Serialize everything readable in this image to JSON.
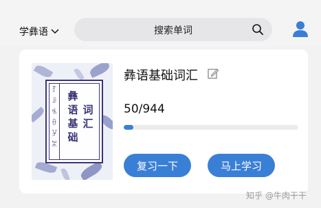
{
  "header": {
    "language": "学彝语",
    "search_placeholder": "搜索单词"
  },
  "book": {
    "title": "彝语基础词汇",
    "cover_title_col1": "彝语基础",
    "cover_title_col2": "词汇",
    "cover_yi_script": "ꆈꌠꁱꂷꐯꄓ"
  },
  "progress": {
    "text": "50/944",
    "learned": 50,
    "total": 944
  },
  "buttons": {
    "review": "复习一下",
    "learn": "马上学习"
  },
  "watermark": "知乎 @牛肉干干",
  "colors": {
    "accent": "#3a7fd6",
    "cover_ink": "#3a3576"
  }
}
